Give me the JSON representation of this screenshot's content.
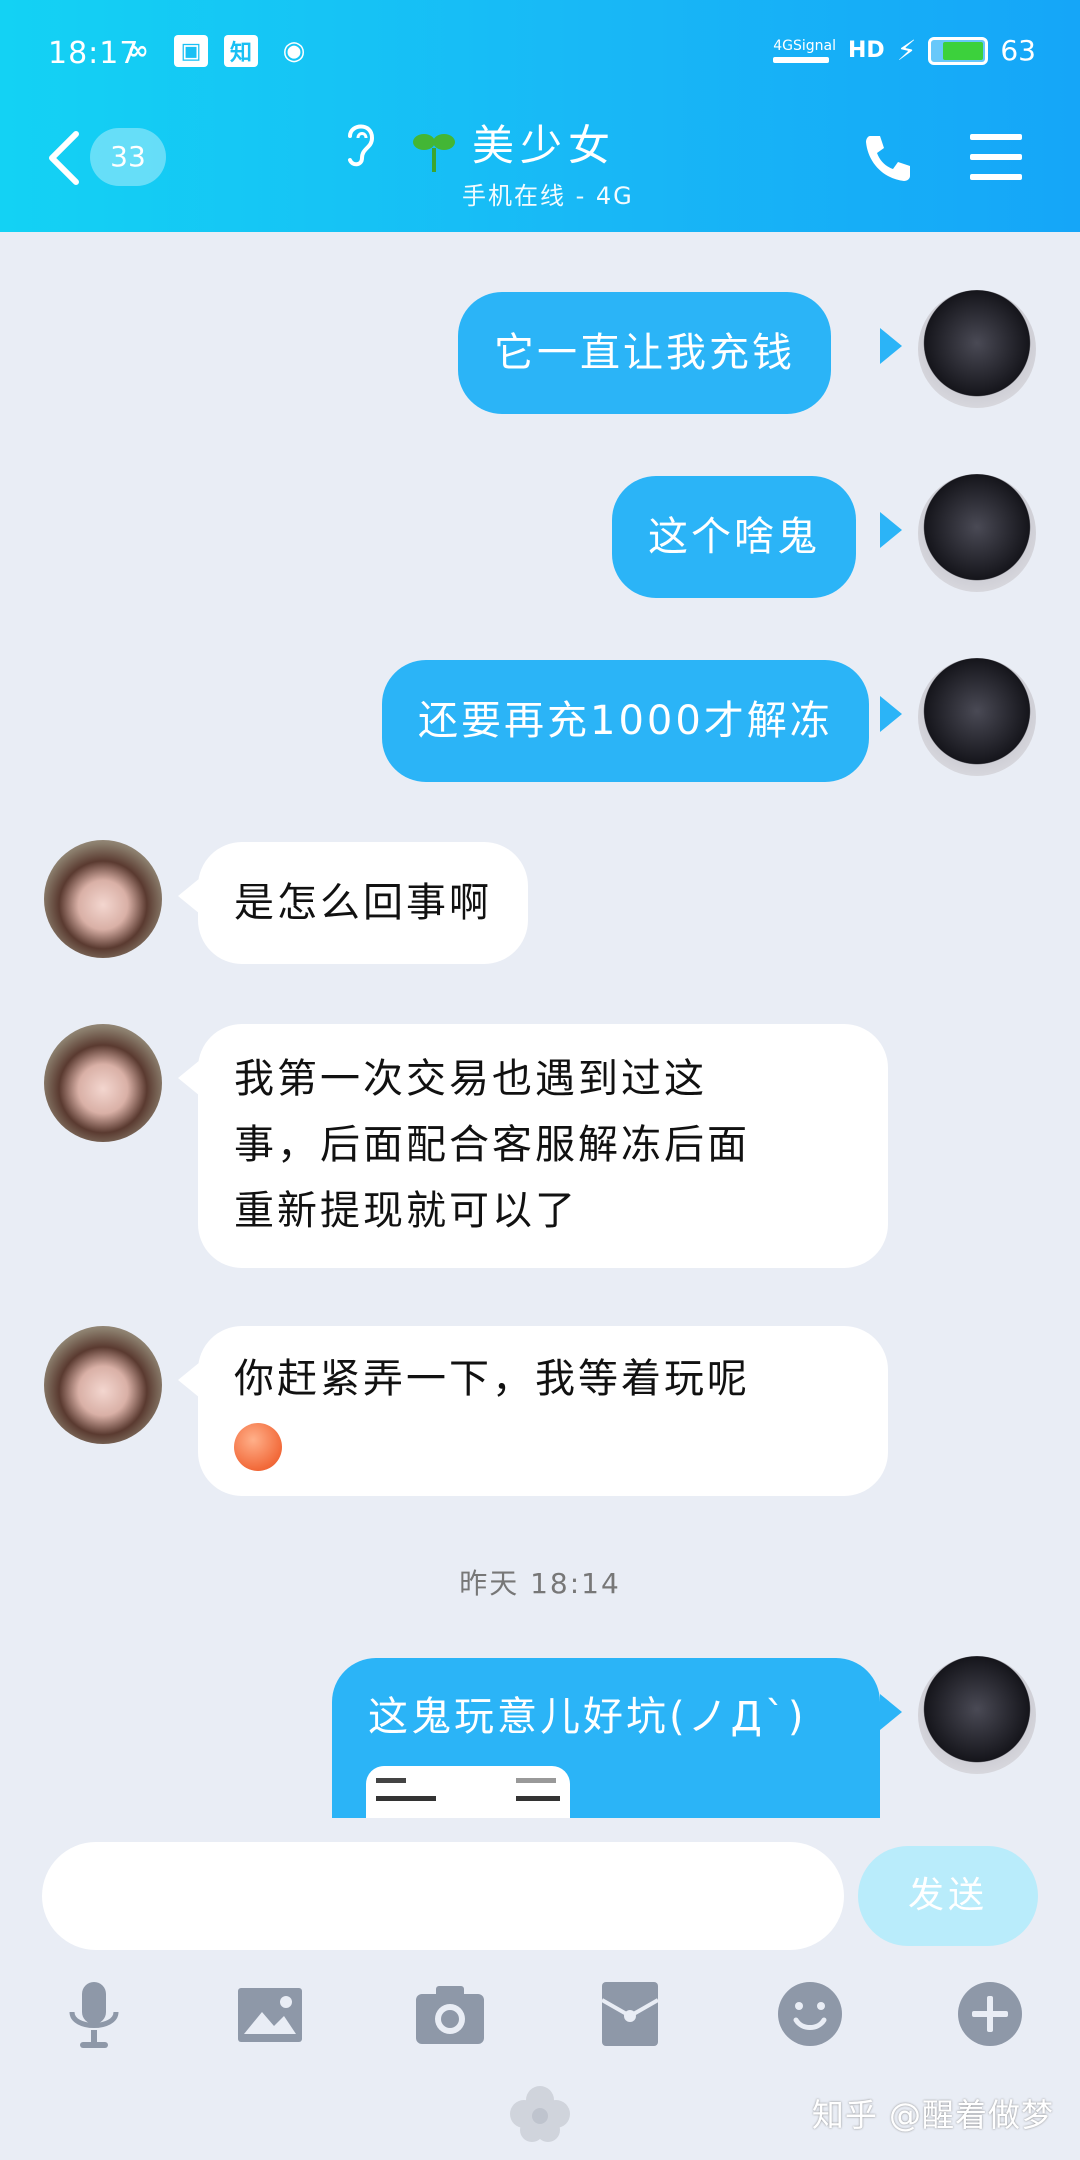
{
  "status_bar": {
    "time": "18:17",
    "network": "4G",
    "signal_label": "Signal",
    "hd": "HD",
    "battery": "63"
  },
  "header": {
    "unread_count": "33",
    "contact_name": "美少女",
    "contact_status": "手机在线 - 4G",
    "accent_color": "#18b8f6"
  },
  "messages": [
    {
      "sender": "me",
      "text": "它一直让我充钱"
    },
    {
      "sender": "me",
      "text": "这个啥鬼"
    },
    {
      "sender": "me",
      "text": "还要再充1000才解冻"
    },
    {
      "sender": "other",
      "text": "是怎么回事啊"
    },
    {
      "sender": "other",
      "text_lines": [
        "我第一次交易也遇到过这",
        "事，后面配合客服解冻后面",
        "重新提现就可以了"
      ]
    },
    {
      "sender": "other",
      "text": "你赶紧弄一下，我等着玩呢",
      "emoji": "flushed-face"
    },
    {
      "sender": "me",
      "text": "这鬼玩意儿好坑(ノД`)"
    }
  ],
  "timestamp": "昨天 18:14",
  "input": {
    "placeholder": "",
    "send_label": "发送"
  },
  "toolbar": [
    "mic-icon",
    "image-icon",
    "camera-icon",
    "red-packet-icon",
    "emoji-icon",
    "plus-icon"
  ],
  "watermark": "知乎 @醒着做梦"
}
